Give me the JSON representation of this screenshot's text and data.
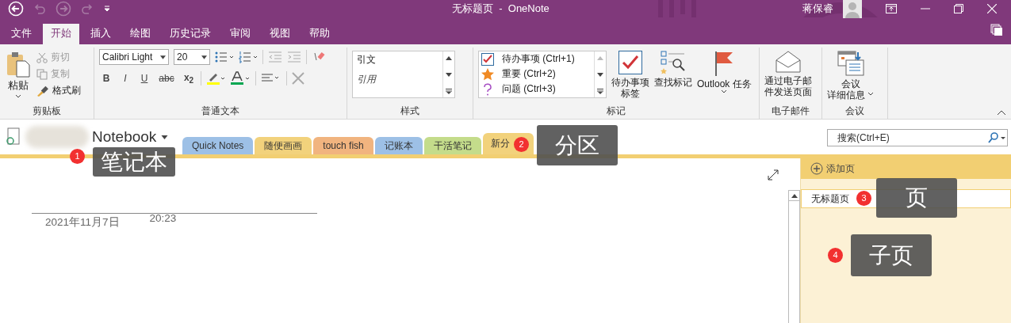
{
  "window": {
    "title": "无标题页  -  OneNote",
    "user": "蒋保睿"
  },
  "menu_tabs": [
    {
      "label": "文件",
      "selected": false
    },
    {
      "label": "开始",
      "selected": true
    },
    {
      "label": "插入",
      "selected": false
    },
    {
      "label": "绘图",
      "selected": false
    },
    {
      "label": "历史记录",
      "selected": false
    },
    {
      "label": "审阅",
      "selected": false
    },
    {
      "label": "视图",
      "selected": false
    },
    {
      "label": "帮助",
      "selected": false
    }
  ],
  "clipboard": {
    "label": "剪贴板",
    "paste": "粘贴",
    "cut": {
      "label": "剪切",
      "disabled": true
    },
    "copy": {
      "label": "复制",
      "disabled": true
    },
    "format_painter": {
      "label": "格式刷",
      "disabled": false
    }
  },
  "basic_text": {
    "label": "普通文本",
    "font": "Calibri Light",
    "size": "20",
    "format_buttons": [
      {
        "kind": "bold",
        "text": "B"
      },
      {
        "kind": "italic",
        "text": "I"
      },
      {
        "kind": "underline",
        "text": "U"
      },
      {
        "kind": "strike",
        "text": "abc"
      },
      {
        "kind": "subscript",
        "text": "x$_{2}$"
      }
    ]
  },
  "styles": {
    "label": "样式",
    "items": [
      "引文",
      "引用"
    ]
  },
  "tags": {
    "label": "标记",
    "items": [
      {
        "kind": "todo",
        "label": "待办事项 (Ctrl+1)"
      },
      {
        "kind": "star",
        "label": "重要 (Ctrl+2)"
      },
      {
        "kind": "question",
        "label": "问题 (Ctrl+3)"
      }
    ],
    "buttons": [
      {
        "kind": "todo",
        "lines": [
          "待办事项",
          "标签"
        ]
      },
      {
        "kind": "find",
        "lines": [
          "查找标记"
        ]
      },
      {
        "kind": "flag",
        "lines": [
          "Outlook 任务"
        ]
      }
    ]
  },
  "email": {
    "label": "电子邮件",
    "lines": [
      "通过电子邮",
      "件发送页面"
    ]
  },
  "meeting": {
    "label": "会议",
    "lines": [
      "会议",
      "详细信息"
    ]
  },
  "notebook": {
    "name": "Notebook"
  },
  "sections": [
    {
      "label": "Quick Notes",
      "color": "#9dc0e6",
      "selected": false
    },
    {
      "label": "随便画画",
      "color": "#f2d27c",
      "selected": false
    },
    {
      "label": "touch fish",
      "color": "#f1b47f",
      "selected": false
    },
    {
      "label": "记账本",
      "color": "#9dc0e6",
      "selected": false
    },
    {
      "label": "干活笔记",
      "color": "#c4dc8b",
      "selected": false
    },
    {
      "label": "新分",
      "color": "#f2d27c",
      "selected": true
    }
  ],
  "search": {
    "placeholder": "搜索(Ctrl+E)"
  },
  "page": {
    "date": "2021年11月7日",
    "time": "20:23"
  },
  "pages_panel": {
    "add_page": "添加页",
    "pages": [
      {
        "title": "无标题页",
        "selected": true
      }
    ]
  },
  "annotations": [
    {
      "number": "1",
      "label": "笔记本"
    },
    {
      "number": "2",
      "label": "分区"
    },
    {
      "number": "3",
      "label": "页"
    },
    {
      "number": "4",
      "label": "子页"
    }
  ]
}
